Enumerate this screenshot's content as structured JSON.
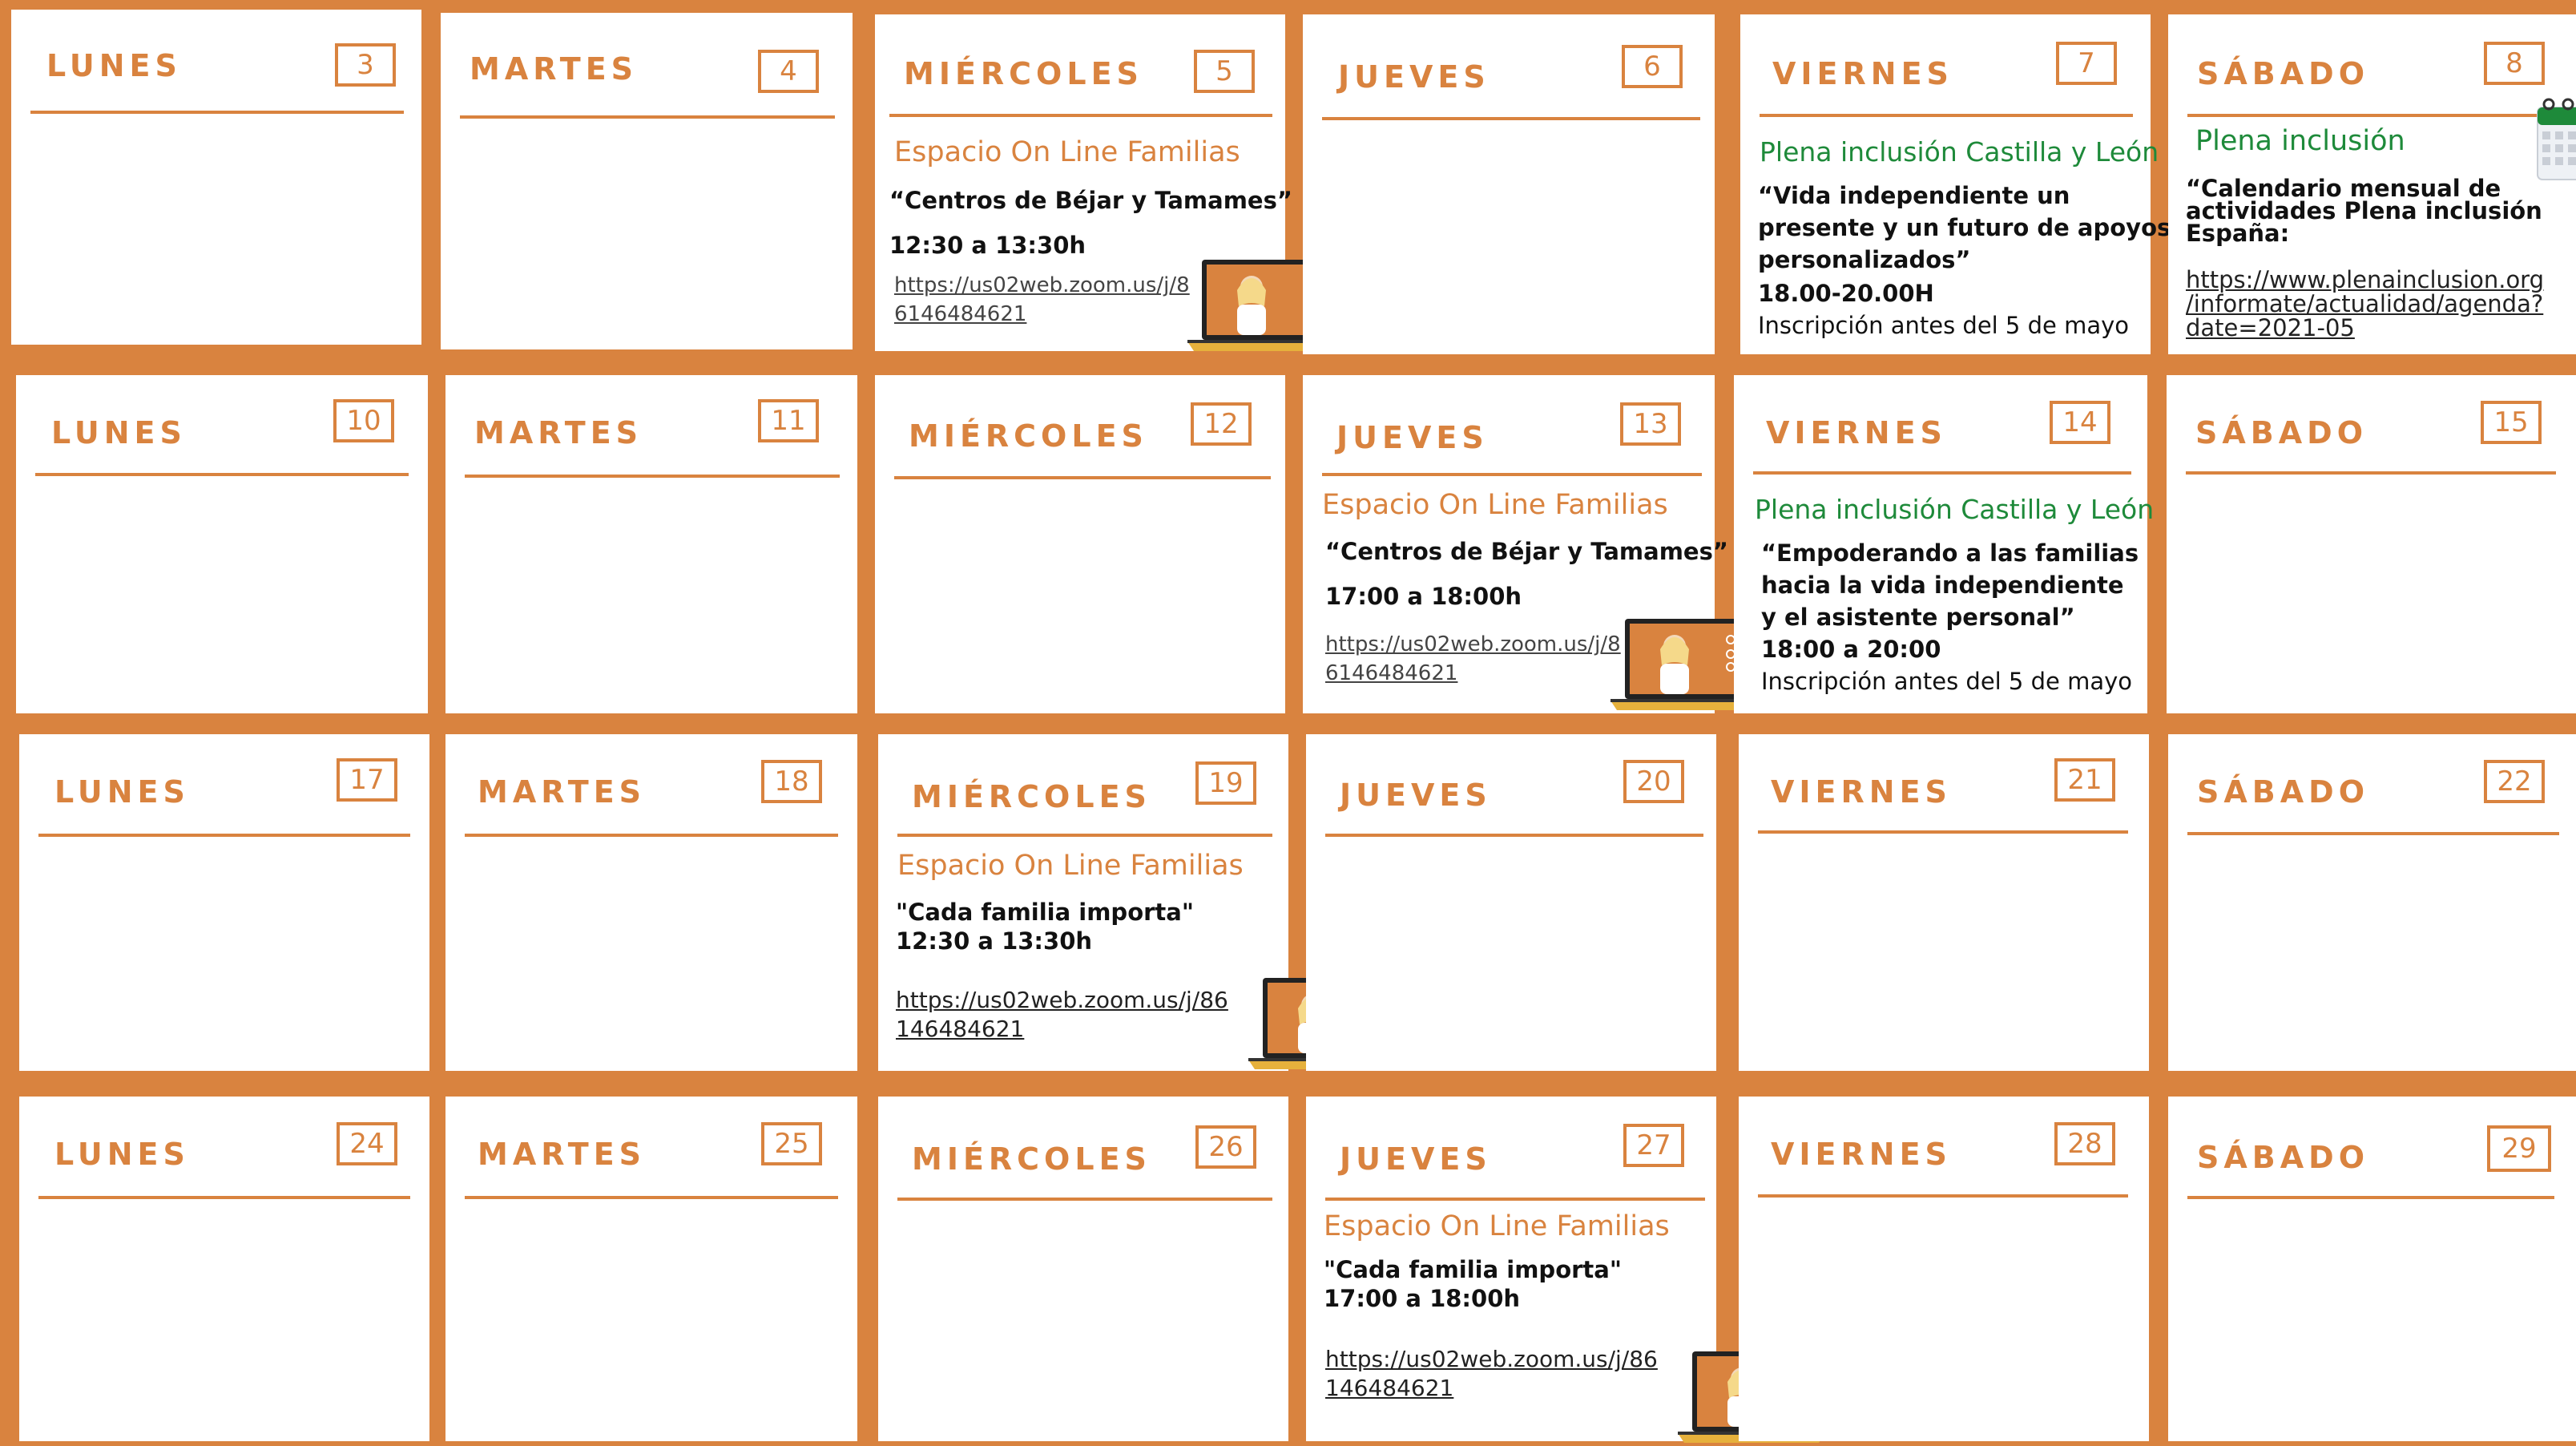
{
  "colors": {
    "accent": "#d9833f",
    "green": "#1e8a3a",
    "text": "#111111"
  },
  "rows": [
    {
      "days": [
        {
          "name": "LUNES",
          "num": "3"
        },
        {
          "name": "MARTES",
          "num": "4"
        },
        {
          "name": "MIÉRCOLES",
          "num": "5",
          "event": {
            "title": "Espacio On Line Familias",
            "lines": [
              "“Centros de Béjar y Tamames”",
              "12:30 a 13:30h"
            ],
            "link": [
              "https://us02web.zoom.us/j/8",
              "6146484621"
            ]
          }
        },
        {
          "name": "JUEVES",
          "num": "6"
        },
        {
          "name": "VIERNES",
          "num": "7",
          "event": {
            "title": "Plena inclusión Castilla y León",
            "lines": [
              "“Vida independiente un",
              "presente y un futuro de apoyos",
              "personalizados”",
              "18.00-20.00H",
              "Inscripción antes del 5 de mayo"
            ]
          }
        },
        {
          "name": "SÁBADO",
          "num": "8",
          "event": {
            "title": "Plena inclusión",
            "lines": [
              "“Calendario mensual de",
              "actividades Plena inclusión",
              "España:"
            ],
            "link": [
              "https://www.plenainclusion.org",
              "/informate/actualidad/agenda?",
              "date=2021-05"
            ]
          }
        }
      ]
    },
    {
      "days": [
        {
          "name": "LUNES",
          "num": "10"
        },
        {
          "name": "MARTES",
          "num": "11"
        },
        {
          "name": "MIÉRCOLES",
          "num": "12"
        },
        {
          "name": "JUEVES",
          "num": "13",
          "event": {
            "title": "Espacio On Line Familias",
            "lines": [
              "“Centros de Béjar y Tamames”",
              "17:00 a 18:00h"
            ],
            "link": [
              "https://us02web.zoom.us/j/8",
              "6146484621"
            ]
          }
        },
        {
          "name": "VIERNES",
          "num": "14",
          "event": {
            "title": "Plena inclusión Castilla y León",
            "lines": [
              "“Empoderando a las familias",
              "hacia la vida independiente",
              "y el asistente personal”",
              "18:00 a 20:00",
              "Inscripción antes del 5 de mayo"
            ]
          }
        },
        {
          "name": "SÁBADO",
          "num": "15"
        }
      ]
    },
    {
      "days": [
        {
          "name": "LUNES",
          "num": "17"
        },
        {
          "name": "MARTES",
          "num": "18"
        },
        {
          "name": "MIÉRCOLES",
          "num": "19",
          "event": {
            "title": "Espacio On Line Familias",
            "lines": [
              "\"Cada familia importa\"",
              "12:30 a 13:30h"
            ],
            "link": [
              "https://us02web.zoom.us/j/86",
              "146484621"
            ]
          }
        },
        {
          "name": "JUEVES",
          "num": "20"
        },
        {
          "name": "VIERNES",
          "num": "21"
        },
        {
          "name": "SÁBADO",
          "num": "22"
        }
      ]
    },
    {
      "days": [
        {
          "name": "LUNES",
          "num": "24"
        },
        {
          "name": "MARTES",
          "num": "25"
        },
        {
          "name": "MIÉRCOLES",
          "num": "26"
        },
        {
          "name": "JUEVES",
          "num": "27",
          "event": {
            "title": "Espacio On Line Familias",
            "lines": [
              "\"Cada familia importa\"",
              "17:00 a 18:00h"
            ],
            "link": [
              "https://us02web.zoom.us/j/86",
              "146484621"
            ]
          }
        },
        {
          "name": "VIERNES",
          "num": "28"
        },
        {
          "name": "SÁBADO",
          "num": "29"
        }
      ]
    }
  ]
}
